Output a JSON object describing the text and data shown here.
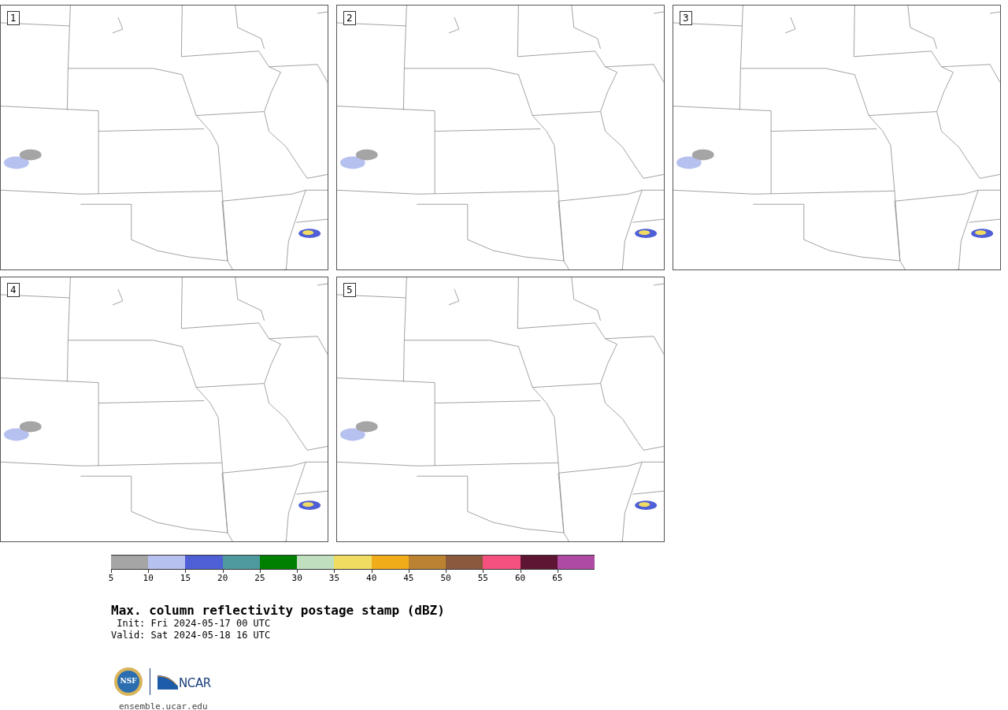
{
  "panels": [
    {
      "label": "1"
    },
    {
      "label": "2"
    },
    {
      "label": "3"
    },
    {
      "label": "4"
    },
    {
      "label": "5"
    }
  ],
  "colorbar": {
    "segments": [
      {
        "color": "#a5a5a5",
        "tick": "5"
      },
      {
        "color": "#b7c1ef",
        "tick": "10"
      },
      {
        "color": "#4f5fd6",
        "tick": "15"
      },
      {
        "color": "#4f9a9e",
        "tick": "20"
      },
      {
        "color": "#008000",
        "tick": "25"
      },
      {
        "color": "#bfdfbf",
        "tick": "30"
      },
      {
        "color": "#f1dc62",
        "tick": "35"
      },
      {
        "color": "#f0ac19",
        "tick": "40"
      },
      {
        "color": "#bb8232",
        "tick": "45"
      },
      {
        "color": "#8b5a3d",
        "tick": "50"
      },
      {
        "color": "#f5517f",
        "tick": "55"
      },
      {
        "color": "#5e1433",
        "tick": "60"
      },
      {
        "color": "#ae4aa3",
        "tick": "65"
      }
    ]
  },
  "title": "Max. column reflectivity postage stamp (dBZ)",
  "init": " Init: Fri 2024-05-17 00 UTC",
  "valid": "Valid: Sat 2024-05-18 16 UTC",
  "logos": {
    "nsf": "NSF",
    "ncar": "NCAR"
  },
  "website": "ensemble.ucar.edu"
}
